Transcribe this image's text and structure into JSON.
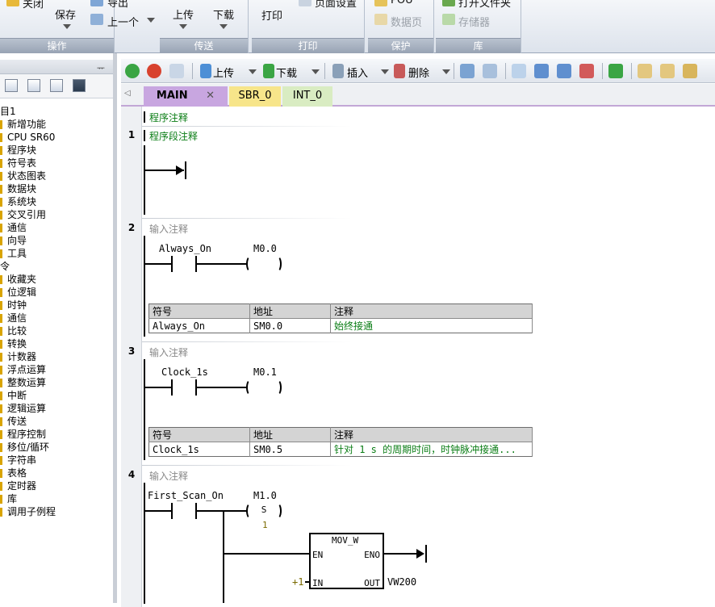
{
  "ribbon": {
    "groups": [
      {
        "name": "操作"
      },
      {
        "name": "传送"
      },
      {
        "name": "打印"
      },
      {
        "name": "保护"
      },
      {
        "name": "库"
      }
    ],
    "close_label": "关闭",
    "save_label": "保存",
    "export_label": "导出",
    "prev_label": "上一个",
    "upload_label": "上传",
    "download_label": "下载",
    "print_label": "打印",
    "page_setup_label": "页面设置",
    "pou_label": "POU",
    "datapage_label": "数据页",
    "open_folder_label": "打开文件夹",
    "memory_label": "存储器"
  },
  "left_pane": {
    "tree": [
      {
        "label": "目1",
        "root": true
      },
      {
        "label": "新增功能"
      },
      {
        "label": "CPU SR60"
      },
      {
        "label": "程序块"
      },
      {
        "label": "符号表"
      },
      {
        "label": "状态图表"
      },
      {
        "label": "数据块"
      },
      {
        "label": "系统块"
      },
      {
        "label": "交叉引用"
      },
      {
        "label": "通信"
      },
      {
        "label": "向导"
      },
      {
        "label": "工具"
      },
      {
        "label": "令",
        "root": true
      },
      {
        "label": "收藏夹"
      },
      {
        "label": "位逻辑"
      },
      {
        "label": "时钟"
      },
      {
        "label": "通信"
      },
      {
        "label": "比较"
      },
      {
        "label": "转换"
      },
      {
        "label": "计数器"
      },
      {
        "label": "浮点运算"
      },
      {
        "label": "整数运算"
      },
      {
        "label": "中断"
      },
      {
        "label": "逻辑运算"
      },
      {
        "label": "传送"
      },
      {
        "label": "程序控制"
      },
      {
        "label": "移位/循环"
      },
      {
        "label": "字符串"
      },
      {
        "label": "表格"
      },
      {
        "label": "定时器"
      },
      {
        "label": "库"
      },
      {
        "label": "调用子例程"
      }
    ]
  },
  "toolbar": {
    "upload": "上传",
    "download": "下载",
    "insert": "插入",
    "delete": "删除"
  },
  "tabs": [
    {
      "label": "MAIN",
      "active": true,
      "color": "#c8a6e0"
    },
    {
      "label": "SBR_0",
      "color": "#f7e58a"
    },
    {
      "label": "INT_0",
      "color": "#d9ecc2"
    }
  ],
  "editor": {
    "program_comment": "程序注释",
    "networks": [
      {
        "num": "1",
        "comment": "程序段注释"
      },
      {
        "num": "2",
        "comment": "输入注释",
        "contact": "Always_On",
        "coil": "M0.0",
        "symbols": {
          "headers": [
            "符号",
            "地址",
            "注释"
          ],
          "row": [
            "Always_On",
            "SM0.0",
            "始终接通"
          ]
        }
      },
      {
        "num": "3",
        "comment": "输入注释",
        "contact": "Clock_1s",
        "coil": "M0.1",
        "symbols": {
          "headers": [
            "符号",
            "地址",
            "注释"
          ],
          "row": [
            "Clock_1s",
            "SM0.5",
            "针对 1 s 的周期时间，时钟脉冲接通..."
          ]
        }
      },
      {
        "num": "4",
        "comment": "输入注释",
        "contact": "First_Scan_On",
        "coil": "M1.0",
        "coil_type": "S",
        "coil_count": "1",
        "box": {
          "title": "MOV_W",
          "en": "EN",
          "eno": "ENO",
          "in": "IN",
          "out": "OUT",
          "in_val": "+1",
          "out_val": "VW200"
        }
      }
    ]
  }
}
